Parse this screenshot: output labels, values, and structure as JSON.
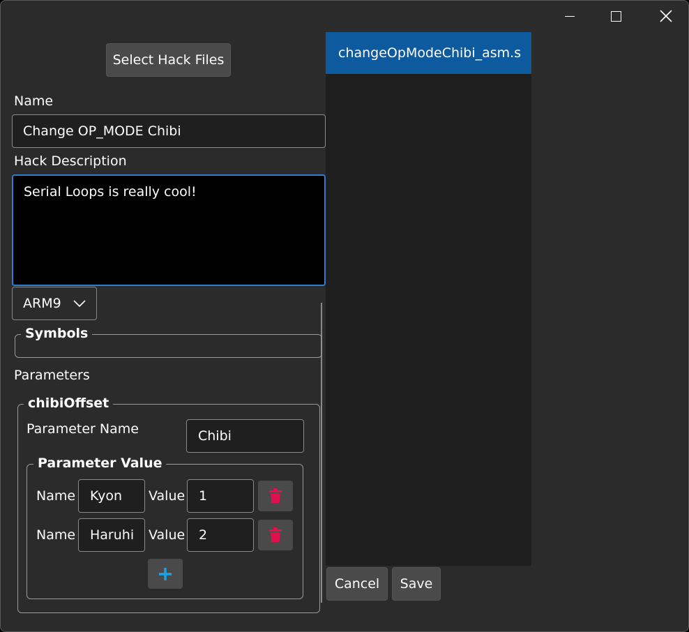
{
  "window": {
    "minimize_icon": "minimize-icon",
    "maximize_icon": "maximize-icon",
    "close_icon": "close-icon"
  },
  "select_files_button": "Select Hack Files",
  "name_field": {
    "label": "Name",
    "value": "Change OP_MODE Chibi"
  },
  "description_field": {
    "label": "Hack Description",
    "value": "Serial Loops is really cool!"
  },
  "target_combo": {
    "selected": "ARM9"
  },
  "symbols_group": {
    "title": "Symbols"
  },
  "parameters": {
    "label": "Parameters",
    "group_title": "chibiOffset",
    "param_name_label": "Parameter Name",
    "param_name_value": "Chibi",
    "value_group_title": "Parameter Value",
    "rows": [
      {
        "name_label": "Name",
        "name_value": "Kyon",
        "value_label": "Value",
        "value_value": "1"
      },
      {
        "name_label": "Name",
        "name_value": "Haruhi",
        "value_label": "Value",
        "value_value": "2"
      }
    ]
  },
  "files_list": {
    "items": [
      "changeOpModeChibi_asm.s"
    ]
  },
  "footer": {
    "cancel_label": "Cancel",
    "save_label": "Save"
  },
  "colors": {
    "accent": "#0e5a9e",
    "focus_border": "#2a7fd4",
    "trash_icon": "#e0104f",
    "add_icon": "#1aa3e8"
  }
}
